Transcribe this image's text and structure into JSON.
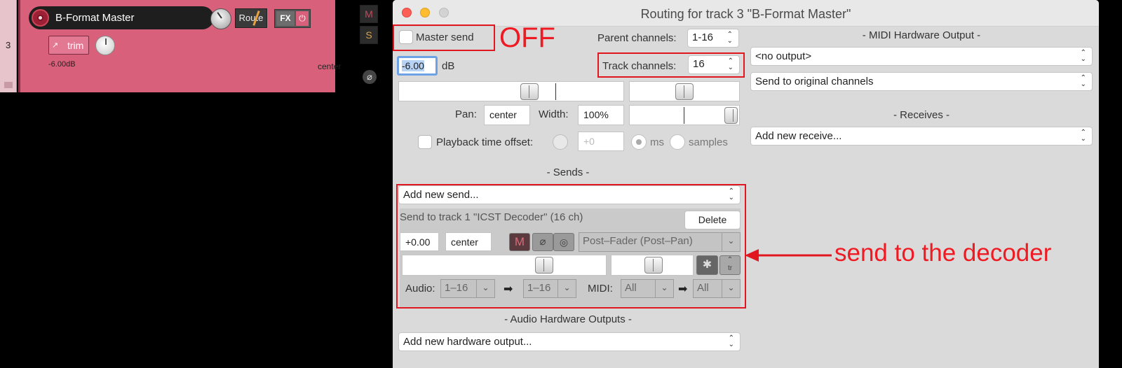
{
  "track": {
    "number": "3",
    "name": "B-Format Master",
    "route_label": "Route",
    "fx_label": "FX",
    "trim_label": "trim",
    "trim_prefix": "↗",
    "volume_readout": "-6.00dB",
    "pan_readout": "center",
    "mute_label": "M",
    "solo_label": "S",
    "phase_symbol": "⌀",
    "color": "#d9607b"
  },
  "window": {
    "title": "Routing for track 3 \"B-Format Master\"",
    "master_send_label": "Master send",
    "master_send_checked": false,
    "volume_value": "-6.00",
    "volume_unit": "dB",
    "parent_channels_label": "Parent channels:",
    "parent_channels_value": "1-16",
    "track_channels_label": "Track channels:",
    "track_channels_value": "16",
    "pan_label": "Pan:",
    "pan_value": "center",
    "width_label": "Width:",
    "width_value": "100%",
    "playback_offset_label": "Playback time offset:",
    "playback_offset_value": "+0",
    "ms_label": "ms",
    "samples_label": "samples",
    "sends_header": "-  Sends  -",
    "add_send_placeholder": "Add new send...",
    "send": {
      "title": "Send to track 1 \"ICST Decoder\" (16 ch)",
      "delete_label": "Delete",
      "volume": "+0.00",
      "pan": "center",
      "mute_label": "M",
      "mode": "Post–Fader (Post–Pan)",
      "audio_label": "Audio:",
      "audio_src": "1–16",
      "audio_dst": "1–16",
      "midi_label": "MIDI:",
      "midi_src": "All",
      "midi_dst": "All",
      "arrow": "➡",
      "tr_label": "tr"
    },
    "audio_hw_header": "-  Audio Hardware Outputs  -",
    "add_hw_output": "Add new hardware output...",
    "midi_hw_header": "-  MIDI Hardware Output  -",
    "midi_output_value": "<no output>",
    "midi_channel_mode": "Send to original channels",
    "receives_header": "-  Receives  -",
    "add_receive": "Add new receive..."
  },
  "annotations": {
    "off_text": "OFF",
    "decoder_text": "send to the decoder",
    "color": "#e2161e"
  }
}
